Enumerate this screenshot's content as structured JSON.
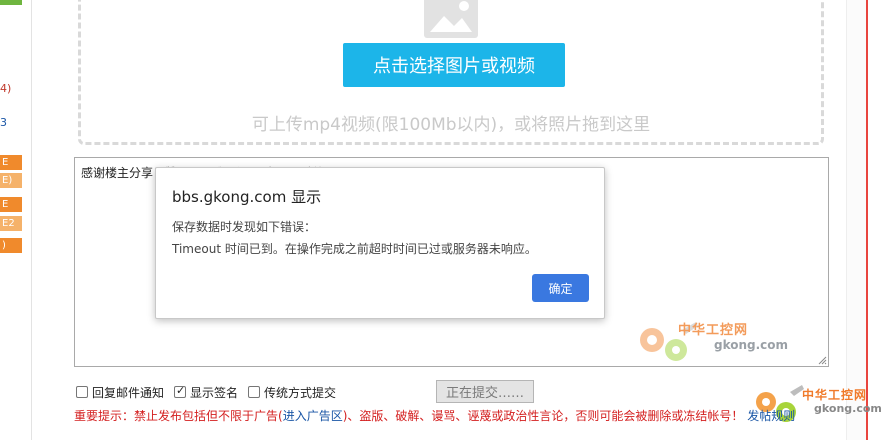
{
  "sidebar": {
    "texts": [
      "4)",
      "3"
    ],
    "tabs": [
      "E",
      "E)",
      "E",
      "E2",
      ")"
    ]
  },
  "upload": {
    "button_label": "点击选择图片或视频",
    "hint": "可上传mp4视频(限100Mb以内)，或将照片拖到这里"
  },
  "reply": {
    "value": "感谢楼主分享！赞一个！我还没用过，10系统"
  },
  "options": [
    {
      "label": "回复邮件通知",
      "checked": false
    },
    {
      "label": "显示签名",
      "checked": true
    },
    {
      "label": "传统方式提交",
      "checked": false
    }
  ],
  "submit_label": "正在提交……",
  "notice": {
    "prefix": "重要提示：禁止发布包括但不限于广告(",
    "link1": "进入广告区",
    "suffix": ")、盗版、破解、谩骂、诬蔑或政治性言论，否则可能会被删除或冻结帐号！",
    "link2": "发帖规则"
  },
  "watermarks": [
    {
      "title": "中华工控网",
      "sub": "gkong.com"
    },
    {
      "title": "中华工控网",
      "sub": "gkong.com"
    }
  ],
  "dialog": {
    "title": "bbs.gkong.com 显示",
    "line1": "保存数据时发现如下错误：",
    "line2": "Timeout 时间已到。在操作完成之前超时时间已过或服务器未响应。",
    "ok_label": "确定"
  },
  "colors": {
    "accent": "#1cb5e9",
    "dialog_button": "#3a78e0",
    "notice_red": "#d42020",
    "link_blue": "#1a56a6"
  }
}
